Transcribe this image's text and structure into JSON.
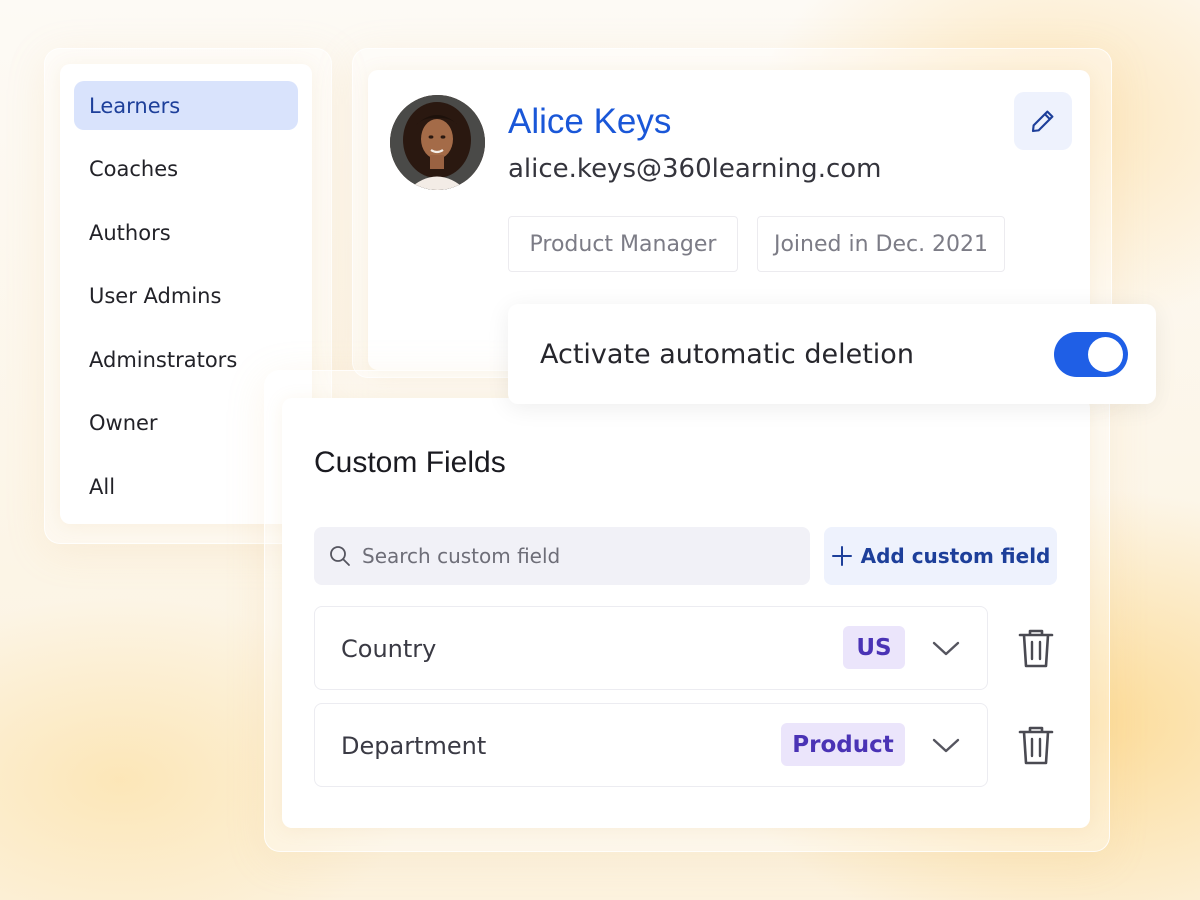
{
  "sidebar": {
    "items": [
      {
        "label": "Learners",
        "active": true
      },
      {
        "label": "Coaches"
      },
      {
        "label": "Authors"
      },
      {
        "label": "User Admins"
      },
      {
        "label": "Adminstrators"
      },
      {
        "label": "Owner"
      },
      {
        "label": "All"
      }
    ]
  },
  "profile": {
    "name": "Alice Keys",
    "email": "alice.keys@360learning.com",
    "chips": {
      "role": "Product Manager",
      "joined": "Joined in Dec. 2021"
    },
    "edit_icon": "pencil-icon"
  },
  "auto_delete": {
    "label": "Activate automatic deletion",
    "enabled": true
  },
  "custom_fields": {
    "title": "Custom Fields",
    "search_placeholder": "Search custom field",
    "add_button_label": "Add custom field",
    "rows": [
      {
        "label": "Country",
        "value": "US"
      },
      {
        "label": "Department",
        "value": "Product"
      }
    ]
  },
  "colors": {
    "accent": "#1f5fe6",
    "link_blue": "#1a57d8",
    "active_nav_bg": "#d9e3fc",
    "tag_bg": "#ebe5fb",
    "tag_text": "#4a33b5"
  }
}
